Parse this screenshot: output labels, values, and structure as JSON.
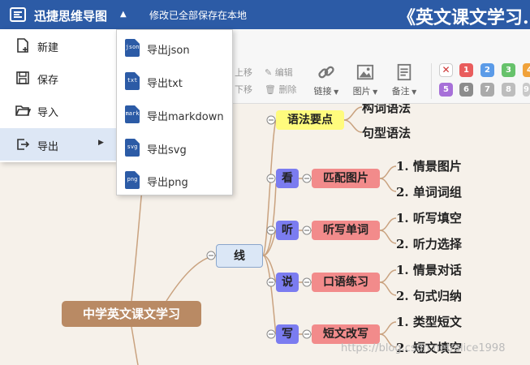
{
  "header": {
    "app_title": "迅捷思维导图",
    "save_status": "修改已全部保存在本地",
    "doc_title": "《英文课文学习."
  },
  "toolbar": {
    "move_up": "上移",
    "move_down": "下移",
    "edit": "编辑",
    "delete": "删除",
    "link": "链接",
    "image": "图片",
    "note": "备注",
    "priorities": [
      "1",
      "2",
      "3",
      "4",
      "5",
      "6",
      "7",
      "8",
      "9"
    ]
  },
  "main_menu": {
    "items": [
      {
        "label": "新建",
        "icon": "new-file-icon"
      },
      {
        "label": "保存",
        "icon": "save-icon"
      },
      {
        "label": "导入",
        "icon": "folder-open-icon"
      },
      {
        "label": "导出",
        "icon": "export-icon"
      }
    ]
  },
  "export_menu": {
    "items": [
      {
        "label": "导出json",
        "badge": "json"
      },
      {
        "label": "导出txt",
        "badge": "txt"
      },
      {
        "label": "导出markdown",
        "badge": "mark"
      },
      {
        "label": "导出svg",
        "badge": "svg"
      },
      {
        "label": "导出png",
        "badge": "png"
      }
    ]
  },
  "mindmap": {
    "root": "中学英文课文学习",
    "branch": "线",
    "grammar": {
      "label": "语法要点",
      "leaves": [
        "构词语法",
        "句型语法"
      ]
    },
    "senses": [
      {
        "sense": "看",
        "skill": "匹配图片",
        "leaves": [
          "1. 情景图片",
          "2. 单词词组"
        ]
      },
      {
        "sense": "听",
        "skill": "听写单词",
        "leaves": [
          "1. 听写填空",
          "2. 听力选择"
        ]
      },
      {
        "sense": "说",
        "skill": "口语练习",
        "leaves": [
          "1. 情景对话",
          "2. 句式归纳"
        ]
      },
      {
        "sense": "写",
        "skill": "短文改写",
        "leaves": [
          "1. 类型短文",
          "2. 短文填空"
        ]
      }
    ]
  },
  "watermark": "https://blog.csdn.net/alice1998",
  "colors": {
    "topbar": "#2c5ba6",
    "root": "#b98a64",
    "sense": "#7b7cf0",
    "skill": "#f28b8b",
    "grammar": "#fffb7d"
  }
}
